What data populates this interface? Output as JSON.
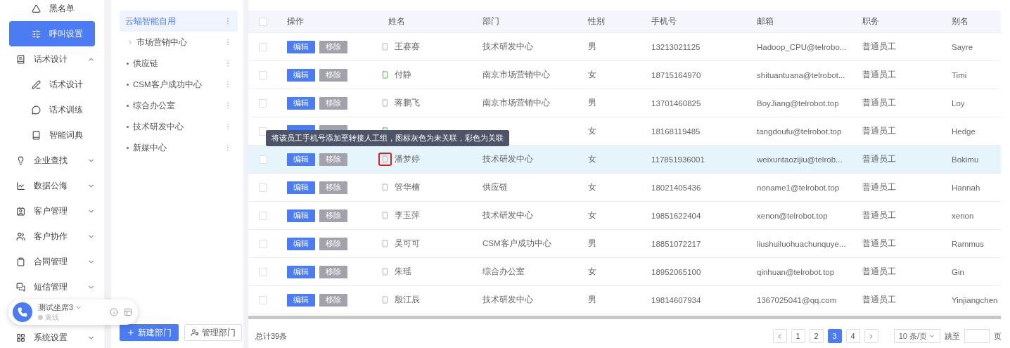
{
  "sidebar": {
    "items": [
      {
        "kind": "sub",
        "label": "黑名单",
        "selected": false
      },
      {
        "kind": "sub",
        "label": "呼叫设置",
        "selected": true
      },
      {
        "kind": "group",
        "label": "话术设计",
        "expanded": true,
        "children": [
          {
            "label": "话术设计",
            "selected": false
          },
          {
            "label": "话术训练",
            "selected": false
          },
          {
            "label": "智能词典",
            "selected": false
          }
        ]
      },
      {
        "kind": "group",
        "label": "企业查找",
        "expanded": false
      },
      {
        "kind": "group",
        "label": "数据公海",
        "expanded": false
      },
      {
        "kind": "group",
        "label": "客户管理",
        "expanded": false
      },
      {
        "kind": "group",
        "label": "客户协作",
        "expanded": false
      },
      {
        "kind": "group",
        "label": "合同管理",
        "expanded": false
      },
      {
        "kind": "group",
        "label": "短信管理",
        "expanded": false
      },
      {
        "kind": "group",
        "label": "系统设置",
        "expanded": false
      }
    ]
  },
  "phone_widget": {
    "agent": "测试坐席3",
    "status": "离线"
  },
  "departments": {
    "items": [
      {
        "kind": "root",
        "label": "云蝠智能自用",
        "selected": true
      },
      {
        "kind": "branch",
        "label": "市场营销中心",
        "selected": false
      },
      {
        "kind": "leaf",
        "label": "供应链",
        "selected": false
      },
      {
        "kind": "leaf",
        "label": "CSM客户成功中心",
        "selected": false
      },
      {
        "kind": "leaf",
        "label": "综合办公室",
        "selected": false
      },
      {
        "kind": "leaf",
        "label": "技术研发中心",
        "selected": false
      },
      {
        "kind": "leaf",
        "label": "新媒中心",
        "selected": false
      }
    ],
    "buttons": [
      "新建部门",
      "管理部门"
    ]
  },
  "table": {
    "columns": [
      "操作",
      "姓名",
      "部门",
      "性别",
      "手机号",
      "邮箱",
      "职务",
      "别名"
    ],
    "all_checked": false,
    "rows": [
      {
        "checked": false,
        "actions": [
          "编辑",
          "移除"
        ],
        "name": "王赛赛",
        "linked": false,
        "highlighted": false,
        "department": "技术研发中心",
        "gender": "男",
        "phone": "13213021125",
        "email": "Hadoop_CPU@telrobo...",
        "title": "普通员工",
        "alias": "Sayre"
      },
      {
        "checked": false,
        "actions": [
          "编辑",
          "移除"
        ],
        "name": "付静",
        "linked": true,
        "highlighted": false,
        "department": "南京市场营销中心",
        "gender": "女",
        "phone": "18715164970",
        "email": "shituantuana@telrobot...",
        "title": "普通员工",
        "alias": "Timi"
      },
      {
        "checked": false,
        "actions": [
          "编辑",
          "移除"
        ],
        "name": "蒋鹏飞",
        "linked": false,
        "highlighted": false,
        "department": "南京市场营销中心",
        "gender": "男",
        "phone": "13701460825",
        "email": "BoyJiang@telrobot.top",
        "title": "普通员工",
        "alias": "Loy"
      },
      {
        "checked": false,
        "linked": true,
        "highlighted": false,
        "gender": "女",
        "phone": "18168119485",
        "email": "tangdoufu@telrobot.top",
        "title": "普通员工",
        "alias": "Hedge"
      },
      {
        "checked": false,
        "actions": [
          "编辑",
          "移除"
        ],
        "name": "潘梦婷",
        "linked": false,
        "highlighted": true,
        "department": "技术研发中心",
        "gender": "女",
        "phone": "117851936001",
        "email": "weixuntaozijiu@telrob...",
        "title": "普通员工",
        "alias": "Bokimu"
      },
      {
        "checked": false,
        "actions": [
          "编辑",
          "移除"
        ],
        "name": "管华楠",
        "linked": false,
        "highlighted": false,
        "department": "供应链",
        "gender": "女",
        "phone": "18021405436",
        "email": "noname1@telrobot.top",
        "title": "普通员工",
        "alias": "Hannah"
      },
      {
        "checked": false,
        "actions": [
          "编辑",
          "移除"
        ],
        "name": "李玉萍",
        "linked": false,
        "highlighted": false,
        "department": "技术研发中心",
        "gender": "女",
        "phone": "19851622404",
        "email": "xenon@telrobot.top",
        "title": "普通员工",
        "alias": "xenon"
      },
      {
        "checked": false,
        "actions": [
          "编辑",
          "移除"
        ],
        "name": "吴可可",
        "linked": false,
        "highlighted": false,
        "department": "CSM客户成功中心",
        "gender": "男",
        "phone": "18851072217",
        "email": "liushuiluohuachunquye...",
        "title": "普通员工",
        "alias": "Rammus"
      },
      {
        "checked": false,
        "actions": [
          "编辑",
          "移除"
        ],
        "name": "朱瑶",
        "linked": false,
        "highlighted": false,
        "department": "综合办公室",
        "gender": "女",
        "phone": "18952065100",
        "email": "qinhuan@telrobot.top",
        "title": "普通员工",
        "alias": "Gin"
      },
      {
        "checked": false,
        "actions": [
          "编辑",
          "移除"
        ],
        "name": "殷江辰",
        "linked": false,
        "highlighted": false,
        "department": "技术研发中心",
        "gender": "男",
        "phone": "19814607934",
        "email": "1367025041@qq.com",
        "title": "普通员工",
        "alias": "Yinjiangchen"
      }
    ]
  },
  "tooltip": "将该员工手机号添加至转接人工组，图标灰色为未关联，彩色为关联",
  "footer": {
    "total": "总计39条",
    "pages": [
      {
        "label": "1",
        "selected": false
      },
      {
        "label": "2",
        "selected": false
      },
      {
        "label": "3",
        "selected": true
      },
      {
        "label": "4",
        "selected": false
      }
    ],
    "page_size": "10 条/页",
    "jump_label": "跳至",
    "page_suffix": "页"
  }
}
